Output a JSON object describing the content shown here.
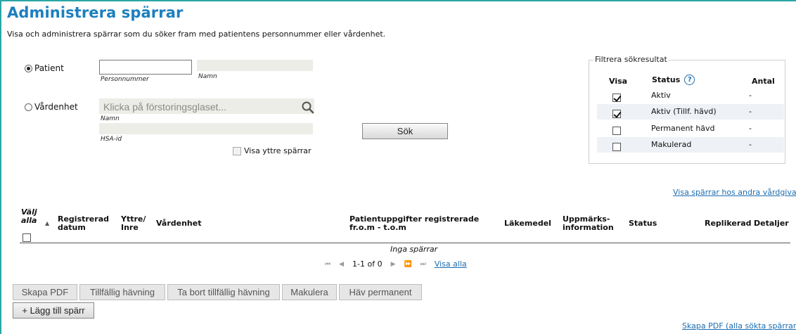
{
  "page": {
    "title": "Administrera spärrar",
    "subtitle": "Visa och administrera spärrar som du söker fram med patientens personnummer eller vårdenhet."
  },
  "search": {
    "patient_label": "Patient",
    "personnummer_value": "",
    "personnummer_caption": "Personnummer",
    "namn_caption": "Namn",
    "vardenhet_label": "Vårdenhet",
    "vardenhet_placeholder": "Klicka på förstoringsglaset...",
    "vardenhet_namn_caption": "Namn",
    "hsa_caption": "HSA-id",
    "visa_yttre_label": "Visa yttre spärrar",
    "sok_button": "Sök",
    "selected": "patient"
  },
  "filter": {
    "legend": "Filtrera sökresultat",
    "headers": {
      "visa": "Visa",
      "status": "Status",
      "antal": "Antal"
    },
    "rows": [
      {
        "status": "Aktiv",
        "checked": true,
        "antal": "-"
      },
      {
        "status": "Aktiv (Tillf. hävd)",
        "checked": true,
        "antal": "-"
      },
      {
        "status": "Permanent hävd",
        "checked": false,
        "antal": "-"
      },
      {
        "status": "Makulerad",
        "checked": false,
        "antal": "-"
      }
    ]
  },
  "links": {
    "other_caregivers": "Visa spärrar hos andra vårdgivare",
    "pdf_all": "Skapa PDF (alla sökta spärrar"
  },
  "table": {
    "headers": {
      "valj_alla": "Välj alla",
      "registrerad": "Registrerad datum",
      "yttre": "Yttre/ Inre",
      "vardenhet": "Vårdenhet",
      "patientuppgifter": "Patientuppgifter registrerade fr.o.m - t.o.m",
      "lakemedel": "Läkemedel",
      "uppmarks": "Uppmärks- information",
      "status": "Status",
      "replikerad": "Replikerad",
      "detaljer": "Detaljer"
    },
    "empty_message": "Inga spärrar",
    "pager": {
      "range": "1-1 of 0",
      "show_all": "Visa alla"
    }
  },
  "actions": {
    "skapa_pdf": "Skapa PDF",
    "tillfallig": "Tillfällig hävning",
    "ta_bort": "Ta bort tillfällig hävning",
    "makulera": "Makulera",
    "hav_permanent": "Häv permanent",
    "lagg_till": "+ Lägg till spärr"
  },
  "colors": {
    "title": "#1c7fbf",
    "frame": "#2aa6a6",
    "link": "#1c6db0"
  }
}
